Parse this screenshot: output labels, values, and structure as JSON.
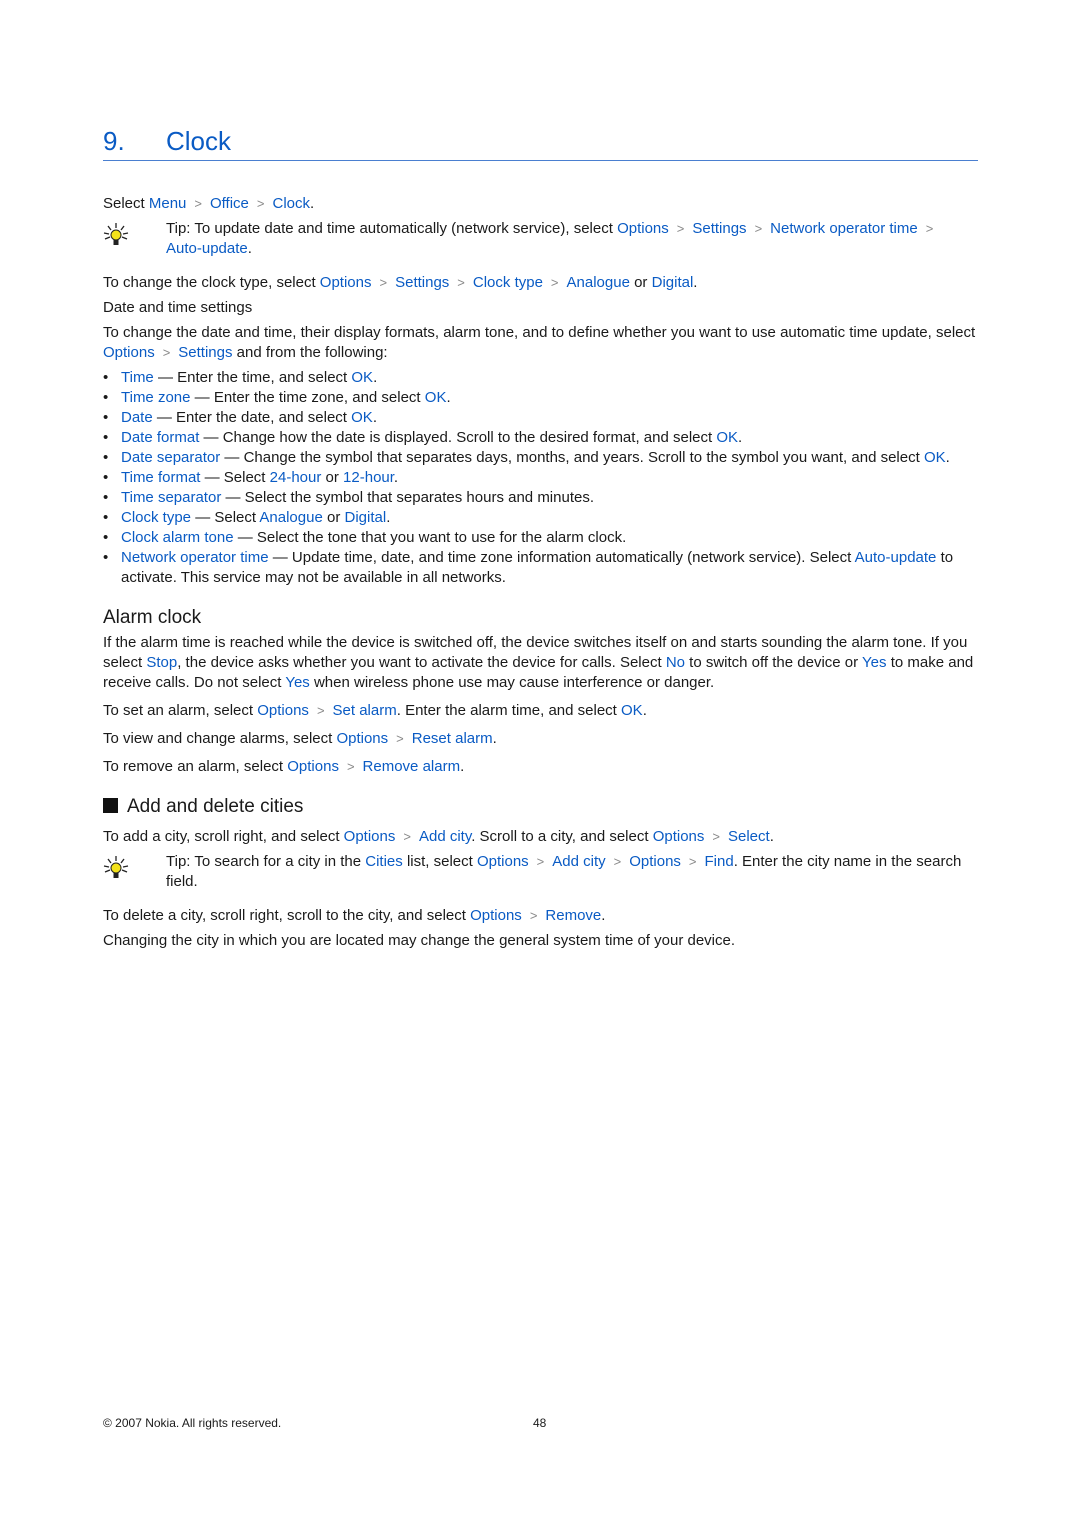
{
  "chapter": {
    "number": "9.",
    "title": "Clock"
  },
  "intro": {
    "select_text": "Select ",
    "path": [
      "Menu",
      "Office",
      "Clock"
    ],
    "end": "."
  },
  "tip1": {
    "label": "Tip:",
    "text": " To update date and time automatically (network service), select ",
    "path": [
      "Options",
      "Settings",
      "Network operator time",
      "Auto-update"
    ],
    "end": "."
  },
  "clock_type": {
    "text": "To change the clock type, select ",
    "path": [
      "Options",
      "Settings",
      "Clock type",
      "Analogue"
    ],
    "or": " or ",
    "alt": "Digital",
    "end": "."
  },
  "date_time_settings": {
    "heading": "Date and time settings",
    "para_a": "To change the date and time, their display formats, alarm tone, and to define whether you want to use automatic time update, select ",
    "path": [
      "Options",
      "Settings"
    ],
    "para_b": " and from the following:",
    "items": [
      {
        "term": "Time",
        "desc": " — Enter the time, and select ",
        "link": "OK",
        "end": "."
      },
      {
        "term": "Time zone",
        "desc": " — Enter the time zone, and select ",
        "link": "OK",
        "end": "."
      },
      {
        "term": "Date",
        "desc": " — Enter the date, and select ",
        "link": "OK",
        "end": "."
      },
      {
        "term": "Date format",
        "desc": " — Change how the date is displayed. Scroll to the desired format, and select ",
        "link": "OK",
        "end": "."
      },
      {
        "term": "Date separator",
        "desc": " — Change the symbol that separates days, months, and years. Scroll to the symbol you want, and select ",
        "link": "OK",
        "end": "."
      },
      {
        "term": "Time format",
        "desc": " — Select ",
        "link": "24-hour",
        "mid": " or ",
        "link2": "12-hour",
        "end": "."
      },
      {
        "term": "Time separator",
        "desc": " — Select the symbol that separates hours and minutes.",
        "link": "",
        "end": ""
      },
      {
        "term": "Clock type",
        "desc": " — Select ",
        "link": "Analogue",
        "mid": " or ",
        "link2": "Digital",
        "end": "."
      },
      {
        "term": "Clock alarm tone",
        "desc": " — Select the tone that you want to use for the alarm clock.",
        "link": "",
        "end": ""
      },
      {
        "term": "Network operator time",
        "desc": " — Update time, date, and time zone information automatically (network service). Select ",
        "link": "Auto-update",
        "end": " to activate. This service may not be available in all networks."
      }
    ]
  },
  "alarm_clock": {
    "heading": "Alarm clock",
    "p1_a": "If the alarm time is reached while the device is switched off, the device switches itself on and starts sounding the alarm tone. If you select ",
    "stop": "Stop",
    "p1_b": ", the device asks whether you want to activate the device for calls. Select ",
    "no": "No",
    "p1_c": " to switch off the device or ",
    "yes": "Yes",
    "p1_d": " to make and receive calls. Do not select ",
    "yes2": "Yes",
    "p1_e": " when wireless phone use may cause interference or danger.",
    "set": {
      "text": "To set an alarm, select ",
      "path": [
        "Options",
        "Set alarm"
      ],
      "after": ". Enter the alarm time, and select ",
      "ok": "OK",
      "end": "."
    },
    "reset": {
      "text": "To view and change alarms, select ",
      "path": [
        "Options",
        "Reset alarm"
      ],
      "end": "."
    },
    "remove": {
      "text": "To remove an alarm, select ",
      "path": [
        "Options",
        "Remove alarm"
      ],
      "end": "."
    }
  },
  "cities": {
    "heading": "Add and delete cities",
    "add": {
      "text": "To add a city, scroll right, and select ",
      "path": [
        "Options",
        "Add city"
      ],
      "mid": ". Scroll to a city, and select ",
      "path2": [
        "Options",
        "Select"
      ],
      "end": "."
    },
    "tip": {
      "label": "Tip:",
      "text": " To search for a city in the ",
      "cities": "Cities",
      "text2": " list, select ",
      "path": [
        "Options",
        "Add city",
        "Options",
        "Find"
      ],
      "end": ". Enter the city name in the search field."
    },
    "delete": {
      "text": "To delete a city, scroll right, scroll to the city, and select ",
      "path": [
        "Options",
        "Remove"
      ],
      "end": "."
    },
    "note": "Changing the city in which you are located may change the general system time of your device."
  },
  "footer": {
    "copyright": "© 2007 Nokia. All rights reserved.",
    "page_number": "48"
  },
  "colors": {
    "link": "#0a5bc4",
    "rule": "#4a7fd0",
    "text": "#1a1a1a"
  }
}
